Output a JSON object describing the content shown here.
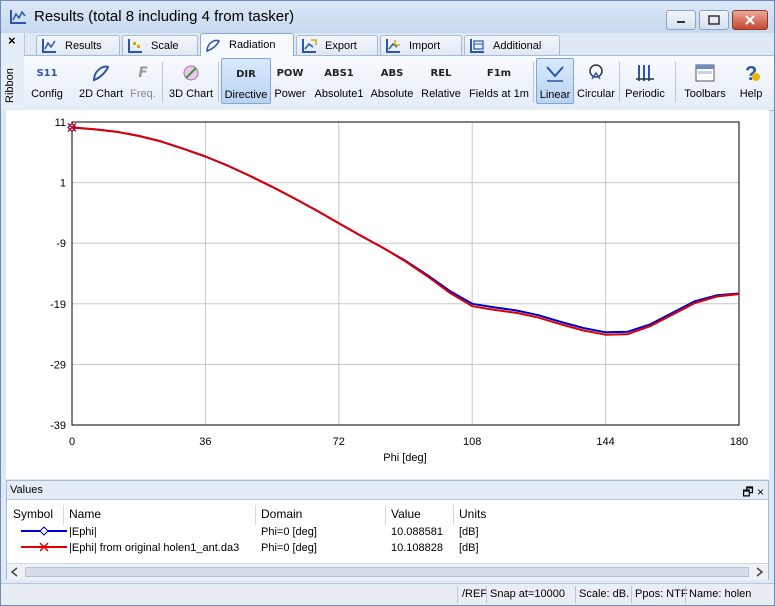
{
  "window": {
    "title": "Results (total 8 including 4 from tasker)"
  },
  "ribbon": {
    "side_label": "Ribbon",
    "close_glyph": "×",
    "tabs": [
      {
        "label": "Results",
        "icon": "results-chart-icon"
      },
      {
        "label": "Scale",
        "icon": "scale-icon"
      },
      {
        "label": "Radiation",
        "icon": "radiation-pattern-icon",
        "active": true
      },
      {
        "label": "Export",
        "icon": "export-icon"
      },
      {
        "label": "Import",
        "icon": "import-icon"
      },
      {
        "label": "Additional",
        "icon": "additional-icon"
      }
    ],
    "buttons": [
      {
        "label": "Config",
        "icon_text": "S11",
        "icon": "s11-config-icon"
      },
      {
        "label": "2D Chart",
        "icon": "2d-chart-icon"
      },
      {
        "label": "Freq.",
        "icon_text": "F",
        "icon": "frequency-icon",
        "disabled": true
      },
      {
        "label": "3D Chart",
        "icon": "3d-chart-icon"
      },
      {
        "label": "Directive",
        "icon_text": "DIR",
        "selected": true
      },
      {
        "label": "Power",
        "icon_text": "POW"
      },
      {
        "label": "Absolute1",
        "icon_text": "ABS1"
      },
      {
        "label": "Absolute",
        "icon_text": "ABS"
      },
      {
        "label": "Relative",
        "icon_text": "REL"
      },
      {
        "label": "Fields at 1m",
        "icon_text": "F1m"
      },
      {
        "label": "Linear",
        "icon": "linear-scale-icon",
        "selected": true
      },
      {
        "label": "Circular",
        "icon": "circular-scale-icon"
      },
      {
        "label": "Periodic",
        "icon": "periodic-icon"
      },
      {
        "label": "Toolbars",
        "icon": "toolbars-icon"
      },
      {
        "label": "Help",
        "icon": "help-icon"
      }
    ]
  },
  "chart_data": {
    "type": "line",
    "title": "",
    "xlabel": "Phi [deg]",
    "ylabel": "",
    "xlim": [
      0,
      180
    ],
    "ylim": [
      -39,
      11
    ],
    "xticks": [
      "0",
      "36",
      "72",
      "108",
      "144",
      "180"
    ],
    "yticks": [
      "11",
      "1",
      "-9",
      "-19",
      "-29",
      "-39"
    ],
    "grid": true,
    "series": [
      {
        "name": "|Ephi|",
        "color": "#0000cc",
        "x": [
          0,
          6,
          12,
          18,
          24,
          30,
          36,
          42,
          48,
          54,
          60,
          66,
          72,
          78,
          84,
          90,
          96,
          102,
          108,
          114,
          120,
          126,
          132,
          138,
          144,
          150,
          156,
          162,
          168,
          174,
          180
        ],
        "y": [
          10.09,
          9.8,
          9.4,
          8.7,
          7.8,
          6.6,
          5.3,
          3.8,
          2.1,
          0.3,
          -1.6,
          -3.6,
          -5.7,
          -7.8,
          -9.8,
          -11.9,
          -14.3,
          -16.9,
          -19.0,
          -19.6,
          -20.1,
          -20.9,
          -22.0,
          -23.0,
          -23.7,
          -23.6,
          -22.4,
          -20.5,
          -18.6,
          -17.6,
          -17.3
        ]
      },
      {
        "name": "|Ephi|  from original holen1_ant.da3",
        "color": "#dd0000",
        "x": [
          0,
          6,
          12,
          18,
          24,
          30,
          36,
          42,
          48,
          54,
          60,
          66,
          72,
          78,
          84,
          90,
          96,
          102,
          108,
          114,
          120,
          126,
          132,
          138,
          144,
          150,
          156,
          162,
          168,
          174,
          180
        ],
        "y": [
          10.11,
          9.8,
          9.4,
          8.7,
          7.8,
          6.6,
          5.3,
          3.8,
          2.1,
          0.3,
          -1.6,
          -3.6,
          -5.7,
          -7.8,
          -9.8,
          -12.0,
          -14.5,
          -17.2,
          -19.4,
          -20.0,
          -20.5,
          -21.3,
          -22.4,
          -23.4,
          -24.1,
          -24.0,
          -22.7,
          -20.8,
          -18.9,
          -17.8,
          -17.4
        ]
      }
    ]
  },
  "values_panel": {
    "title": "Values",
    "controls": "🗗 ×",
    "columns": [
      "Symbol",
      "Name",
      "Domain",
      "Value",
      "Units"
    ],
    "rows": [
      {
        "name": "|Ephi|",
        "domain": "Phi=0 [deg]",
        "value": "10.088581",
        "units": "[dB]",
        "color": "#0000cc"
      },
      {
        "name": "|Ephi|  from original holen1_ant.da3",
        "domain": "Phi=0 [deg]",
        "value": "10.108828",
        "units": "[dB]",
        "color": "#dd0000"
      }
    ]
  },
  "statusbar": {
    "ref": "/REF",
    "snap": "Snap at=10000",
    "scale": "Scale: dB.",
    "ppos": "Ppos: NTF",
    "name": "Name: holen"
  }
}
